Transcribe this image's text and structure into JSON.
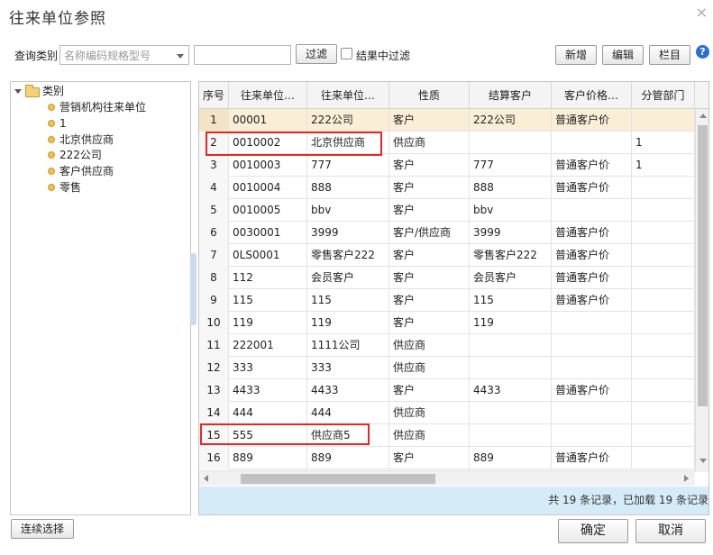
{
  "dialog": {
    "title": "往来单位参照",
    "close_glyph": "×"
  },
  "toolbar": {
    "query_label": "查询类别",
    "category_placeholder": "名称编码规格型号",
    "search_value": "",
    "filter_button": "过滤",
    "filter_in_results_label": "结果中过滤",
    "filter_in_results_checked": false,
    "add_button": "新增",
    "edit_button": "编辑",
    "columns_button": "栏目",
    "help_glyph": "?"
  },
  "tree": {
    "root": {
      "label": "类别",
      "expanded": true,
      "icon": "folder-icon"
    },
    "items": [
      {
        "label": "营销机构往来单位"
      },
      {
        "label": "1"
      },
      {
        "label": "北京供应商"
      },
      {
        "label": "222公司"
      },
      {
        "label": "客户供应商"
      },
      {
        "label": "零售"
      }
    ]
  },
  "grid": {
    "columns": [
      "序号",
      "往来单位…",
      "往来单位…",
      "性质",
      "结算客户",
      "客户价格…",
      "分管部门"
    ],
    "rows": [
      [
        "1",
        "00001",
        "222公司",
        "客户",
        "222公司",
        "普通客户价",
        ""
      ],
      [
        "2",
        "0010002",
        "北京供应商",
        "供应商",
        "",
        "",
        "1"
      ],
      [
        "3",
        "0010003",
        "777",
        "客户",
        "777",
        "普通客户价",
        "1"
      ],
      [
        "4",
        "0010004",
        "888",
        "客户",
        "888",
        "普通客户价",
        ""
      ],
      [
        "5",
        "0010005",
        "bbv",
        "客户",
        "bbv",
        "",
        ""
      ],
      [
        "6",
        "0030001",
        "3999",
        "客户/供应商",
        "3999",
        "普通客户价",
        ""
      ],
      [
        "7",
        "0LS0001",
        "零售客户222",
        "客户",
        "零售客户222",
        "普通客户价",
        ""
      ],
      [
        "8",
        "112",
        "会员客户",
        "客户",
        "会员客户",
        "普通客户价",
        ""
      ],
      [
        "9",
        "115",
        "115",
        "客户",
        "115",
        "普通客户价",
        ""
      ],
      [
        "10",
        "119",
        "119",
        "客户",
        "119",
        "",
        ""
      ],
      [
        "11",
        "222001",
        "1111公司",
        "供应商",
        "",
        "",
        ""
      ],
      [
        "12",
        "333",
        "333",
        "供应商",
        "",
        "",
        ""
      ],
      [
        "13",
        "4433",
        "4433",
        "客户",
        "4433",
        "普通客户价",
        ""
      ],
      [
        "14",
        "444",
        "444",
        "供应商",
        "",
        "",
        ""
      ],
      [
        "15",
        "555",
        "供应商5",
        "供应商",
        "",
        "",
        ""
      ],
      [
        "16",
        "889",
        "889",
        "客户",
        "889",
        "普通客户价",
        ""
      ]
    ],
    "selected_row": 1,
    "status_text": "共 19 条记录，已加载 19 条记录"
  },
  "footer": {
    "continuous_select_button": "连续选择",
    "ok_button": "确定",
    "cancel_button": "取消"
  },
  "colors": {
    "selected_row": "#fbeed6",
    "status_bar": "#d6ebf8",
    "highlight_box": "#e52626",
    "help_icon": "#2b6fd4"
  }
}
